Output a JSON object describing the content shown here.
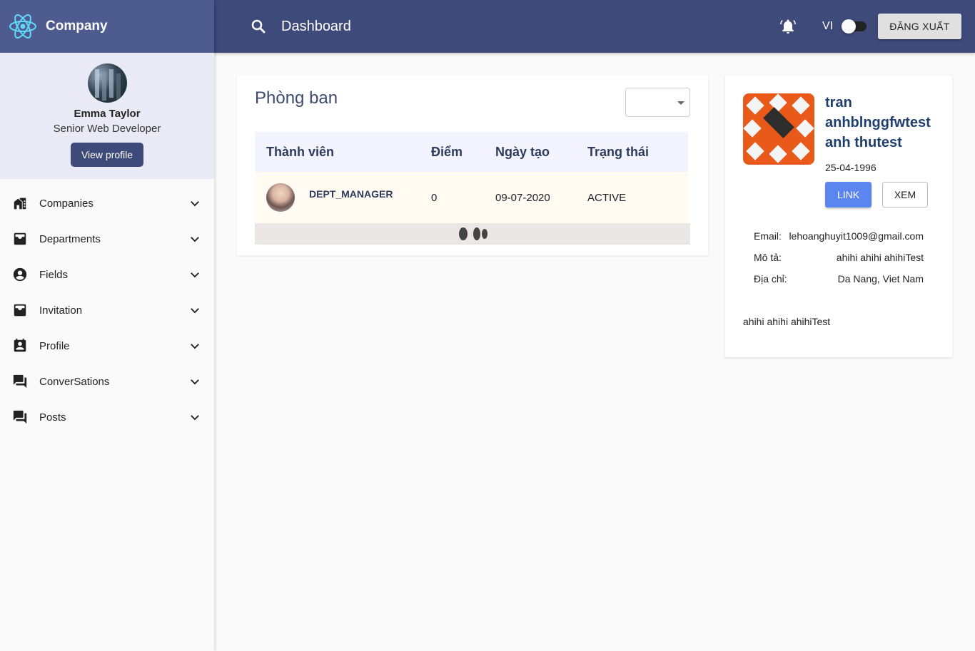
{
  "brand": {
    "name": "Company",
    "logo_icon": "react-atom-icon",
    "logo_color": "#61dafb"
  },
  "user": {
    "name": "Emma Taylor",
    "role": "Senior Web Developer",
    "view_profile_label": "View profile"
  },
  "nav": [
    {
      "label": "Companies",
      "icon": "companies-icon"
    },
    {
      "label": "Departments",
      "icon": "inbox-icon"
    },
    {
      "label": "Fields",
      "icon": "account-circle-icon"
    },
    {
      "label": "Invitation",
      "icon": "inbox-icon"
    },
    {
      "label": "Profile",
      "icon": "contact-card-icon"
    },
    {
      "label": "ConverSations",
      "icon": "forum-icon"
    },
    {
      "label": "Posts",
      "icon": "forum-icon"
    }
  ],
  "header": {
    "title": "Dashboard",
    "lang": "VI",
    "logout_label": "ĐĂNG XUẤT"
  },
  "department": {
    "title": "Phòng ban",
    "columns": [
      "Thành viên",
      "Điểm",
      "Ngày tạo",
      "Trạng thái"
    ],
    "rows": [
      {
        "member": "DEPT_MANAGER",
        "score": "0",
        "created": "09-07-2020",
        "status": "ACTIVE"
      }
    ]
  },
  "profile": {
    "name": "tran anhblnggfwtest anh thutest",
    "dob": "25-04-1996",
    "link_label": "LINK",
    "view_label": "XEM",
    "email_label": "Email:",
    "email": "lehoanghuyit1009@gmail.com",
    "desc_label": "Mô tả:",
    "desc": "ahihi ahihi ahihiTest",
    "address_label": "Địa chỉ:",
    "address": "Da Nang, Viet Nam",
    "bio": "ahihi ahihi ahihiTest"
  },
  "colors": {
    "header": "#3d4a7a",
    "brand_bg": "#4e5b8f",
    "accent": "#5b86f0",
    "title": "#1e3f6e"
  }
}
